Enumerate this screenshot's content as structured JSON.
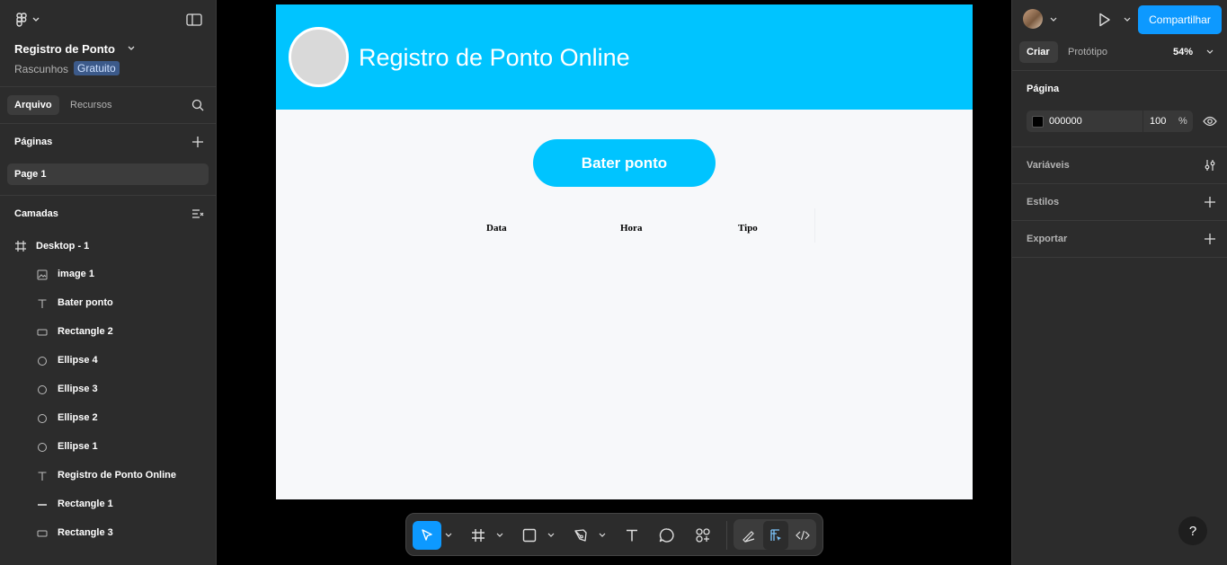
{
  "file": {
    "name": "Registro de Ponto",
    "location": "Rascunhos",
    "plan_badge": "Gratuito"
  },
  "left_tabs": {
    "file": "Arquivo",
    "assets": "Recursos"
  },
  "pages": {
    "heading": "Páginas",
    "items": [
      "Page 1"
    ]
  },
  "layers": {
    "heading": "Camadas",
    "frame": "Desktop - 1",
    "items": [
      {
        "label": "image 1",
        "icon": "image-icon"
      },
      {
        "label": "Bater ponto",
        "icon": "text-icon"
      },
      {
        "label": "Rectangle 2",
        "icon": "rectangle-icon"
      },
      {
        "label": "Ellipse 4",
        "icon": "ellipse-icon"
      },
      {
        "label": "Ellipse 3",
        "icon": "ellipse-icon"
      },
      {
        "label": "Ellipse 2",
        "icon": "ellipse-icon"
      },
      {
        "label": "Ellipse 1",
        "icon": "ellipse-icon"
      },
      {
        "label": "Registro de Ponto Online",
        "icon": "text-icon"
      },
      {
        "label": "Rectangle 1",
        "icon": "line-rectangle-icon"
      },
      {
        "label": "Rectangle 3",
        "icon": "rectangle-icon"
      }
    ]
  },
  "design": {
    "title": "Registro de Ponto Online",
    "button": "Bater ponto",
    "columns": [
      "Data",
      "Hora",
      "Tipo"
    ],
    "header_color": "#00c4ff",
    "background_color": "#f7f8fa"
  },
  "right": {
    "share": "Compartilhar",
    "tabs": {
      "design": "Criar",
      "prototype": "Protótipo"
    },
    "zoom": "54%",
    "page_section": "Página",
    "page_color": "000000",
    "page_opacity": "100",
    "percent": "%",
    "variables": "Variáveis",
    "styles": "Estilos",
    "export": "Exportar",
    "help": "?"
  },
  "colors": {
    "accent": "#0d99ff",
    "panel": "#2c2c2c"
  }
}
